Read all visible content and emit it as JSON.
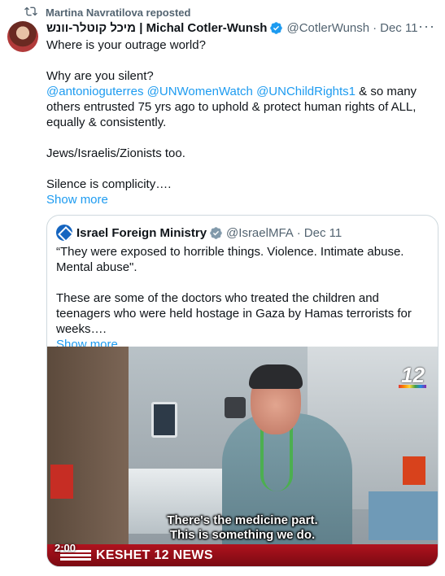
{
  "repost": {
    "text": "Martina Navratilova reposted",
    "icon": "repost-icon"
  },
  "tweet": {
    "display_name": "מיכל קוטלר-וונש | Michal Cotler-Wunsh",
    "handle": "@CotlerWunsh",
    "separator": "·",
    "date": "Dec 11",
    "more_icon": "···",
    "line1": "Where is your outrage world?",
    "line2": "Why are you silent?",
    "mention1": "@antonioguterres",
    "mention2": "@UNWomenWatch",
    "mention3": "@UNChildRights1",
    "line3_rest": " & so many others entrusted 75 yrs ago to uphold & protect human rights of ALL, equally & consistently.",
    "line4": "Jews/Israelis/Zionists too.",
    "line5": "Silence is complicity….",
    "show_more": "Show more",
    "verified_color": "#1d9bf0"
  },
  "quote": {
    "display_name": "Israel Foreign Ministry",
    "handle": "@IsraelMFA",
    "separator": "·",
    "date": "Dec 11",
    "line1": "“They were exposed to horrible things. Violence. Intimate abuse. Mental abuse\".",
    "line2": "These are some of the doctors who treated the children and teenagers who were held hostage in Gaza by Hamas terrorists for weeks….",
    "show_more": "Show more",
    "verified_color": "#829aab"
  },
  "video": {
    "channel_logo": "12",
    "subtitle_line1": "There's the medicine part.",
    "subtitle_line2": "This is something we do.",
    "ticker": "KESHET 12 NEWS",
    "duration": "2:00"
  }
}
